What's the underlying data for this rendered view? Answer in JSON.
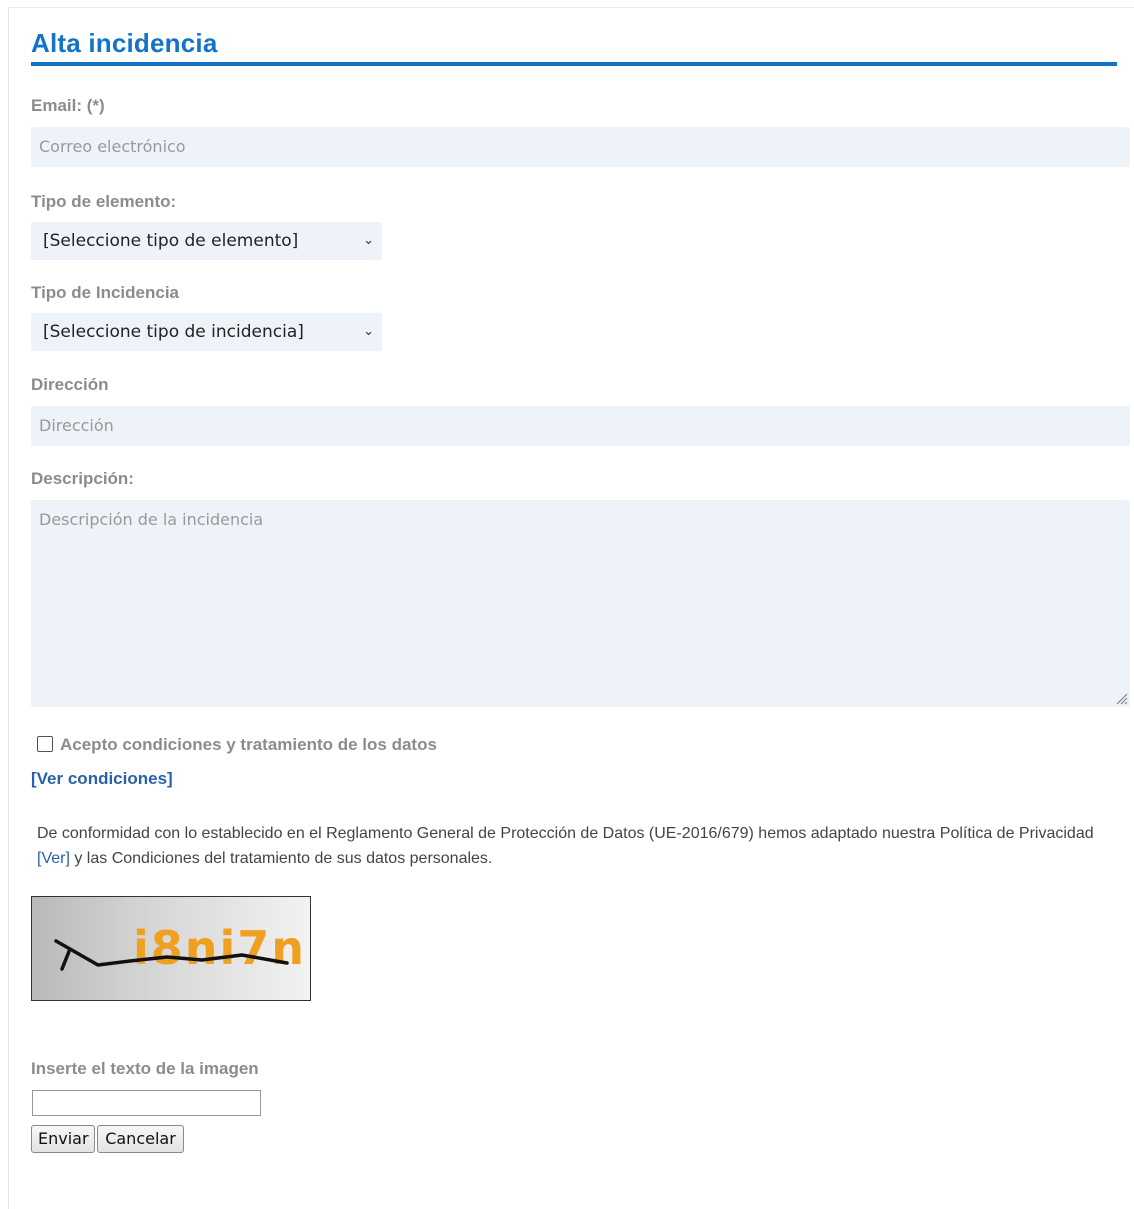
{
  "page": {
    "title": "Alta incidencia"
  },
  "form": {
    "email": {
      "label": "Email: (*)",
      "placeholder": "Correo electrónico"
    },
    "element_type": {
      "label": "Tipo de elemento:",
      "selected": "[Seleccione tipo de elemento]"
    },
    "incident_type": {
      "label": "Tipo de Incidencia",
      "selected": "[Seleccione tipo de incidencia]"
    },
    "address": {
      "label": "Dirección",
      "placeholder": "Dirección"
    },
    "description": {
      "label": "Descripción:",
      "placeholder": "Descripción de la incidencia"
    },
    "accept": {
      "label": "Acepto condiciones y tratamiento de los datos",
      "checked": false
    },
    "conditions_link": "[Ver condiciones]",
    "privacy": {
      "text_before": "De conformidad con lo establecido en el Reglamento General de Protección de Datos (UE-2016/679) hemos adaptado nuestra Política de Privacidad ",
      "link": "[Ver]",
      "text_after": " y las Condiciones del tratamiento de sus datos personales."
    },
    "captcha": {
      "text": "i8ni7n",
      "prompt": "Inserte el texto de la imagen",
      "value": ""
    },
    "buttons": {
      "submit": "Enviar",
      "cancel": "Cancelar"
    }
  },
  "colors": {
    "accent": "#1273c9",
    "link": "#2a62a8",
    "label": "#8c8c8c",
    "field_bg": "#eef3f9",
    "captcha_text": "#f0a020"
  },
  "icons": {
    "select_arrow": "chevron-down-icon",
    "textarea_grip": "resize-grip-icon"
  }
}
